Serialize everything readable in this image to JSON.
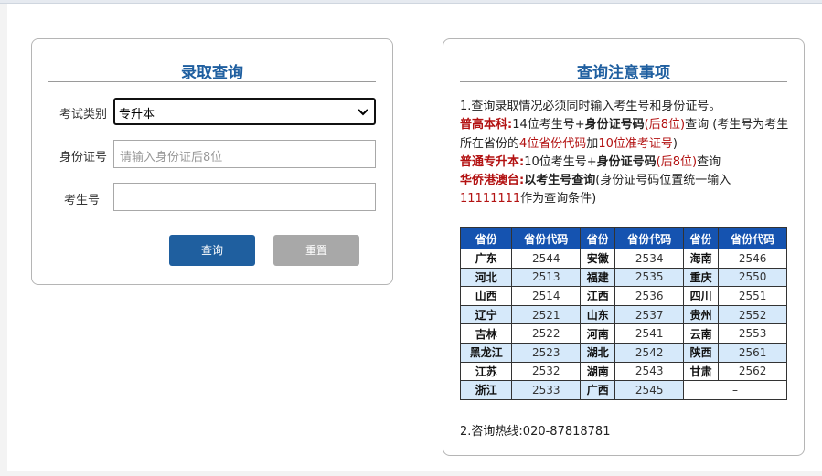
{
  "left_panel": {
    "title": "录取查询",
    "exam_type_label": "考试类别",
    "exam_type_value": "专升本",
    "id_label": "身份证号",
    "id_placeholder": "请输入身份证后8位",
    "exam_no_label": "考生号",
    "query_button": "查询",
    "reset_button": "重置"
  },
  "right_panel": {
    "title": "查询注意事项",
    "note1": "1.查询录取情况必须同时输入考生号和身份证号。",
    "gk_label": "普高本科:",
    "gk_text1": "14位考生号+",
    "gk_bold": "身份证号码",
    "gk_red": "(后8位)",
    "gk_text2": "查询 (考生号为考生所在省份的",
    "gk_red2": "4位省份代码",
    "gk_text3": "加",
    "gk_red3": "10位准考证号",
    "gk_text4": ")",
    "zsb_label": "普通专升本:",
    "zsb_text1": "10位考生号+",
    "zsb_bold": "身份证号码",
    "zsb_red": "(后8位)",
    "zsb_text2": "查询",
    "hq_label": "华侨港澳台:",
    "hq_bold": "以考生号查询",
    "hq_text1": "(身份证号码位置统一输入",
    "hq_red": "11111111",
    "hq_text2": "作为查询条件)",
    "table_headers": [
      "省份",
      "省份代码",
      "省份",
      "省份代码",
      "省份",
      "省份代码"
    ],
    "table_rows": [
      [
        "广东",
        "2544",
        "安徽",
        "2534",
        "海南",
        "2546"
      ],
      [
        "河北",
        "2513",
        "福建",
        "2535",
        "重庆",
        "2550"
      ],
      [
        "山西",
        "2514",
        "江西",
        "2536",
        "四川",
        "2551"
      ],
      [
        "辽宁",
        "2521",
        "山东",
        "2537",
        "贵州",
        "2552"
      ],
      [
        "吉林",
        "2522",
        "河南",
        "2541",
        "云南",
        "2553"
      ],
      [
        "黑龙江",
        "2523",
        "湖北",
        "2542",
        "陕西",
        "2561"
      ],
      [
        "江苏",
        "2532",
        "湖南",
        "2543",
        "甘肃",
        "2562"
      ],
      [
        "浙江",
        "2533",
        "广西",
        "2545",
        "–",
        ""
      ]
    ],
    "hotline_label": "2.咨询热线:",
    "hotline_number": "020-87818781"
  },
  "colors": {
    "title_blue": "#1f5fa0",
    "header_blue": "#1553b0",
    "row_alt": "#d6e9fa",
    "red": "#b31212",
    "button_primary": "#1f5f9f",
    "button_gray": "#a8a8a8"
  }
}
